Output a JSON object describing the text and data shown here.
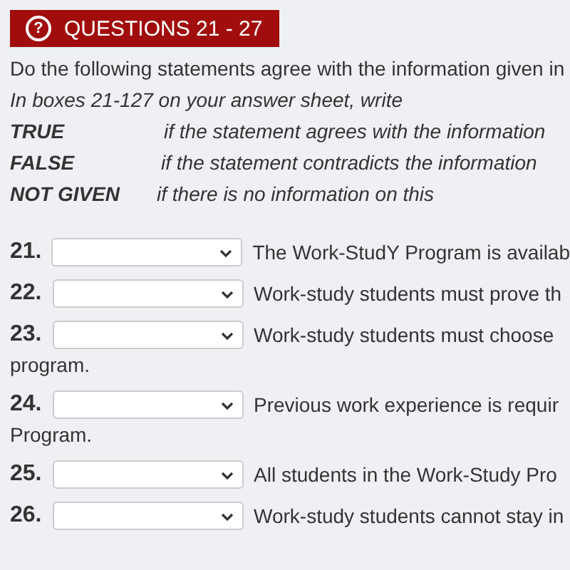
{
  "header": {
    "icon": "?",
    "title": "QUESTIONS 21 - 27"
  },
  "instruction": "Do the following statements agree with the information given in",
  "note": "In boxes 21-127 on your answer sheet, write",
  "legend": [
    {
      "term": "TRUE",
      "meaning": "if the statement agrees with the information"
    },
    {
      "term": "FALSE",
      "meaning": "if the statement contradicts the information"
    },
    {
      "term": "NOT GIVEN",
      "meaning": "if there is no information on this"
    }
  ],
  "questions": [
    {
      "number": "21.",
      "statement": "The Work-StudY Program is availab"
    },
    {
      "number": "22.",
      "statement": "Work-study students must prove th"
    },
    {
      "number": "23.",
      "statement": "Work-study students must choose",
      "continuation": "program."
    },
    {
      "number": "24.",
      "statement": "Previous work experience is requir",
      "continuation": "Program."
    },
    {
      "number": "25.",
      "statement": "All students in the Work-Study Pro"
    },
    {
      "number": "26.",
      "statement": "Work-study students cannot stay in"
    }
  ]
}
